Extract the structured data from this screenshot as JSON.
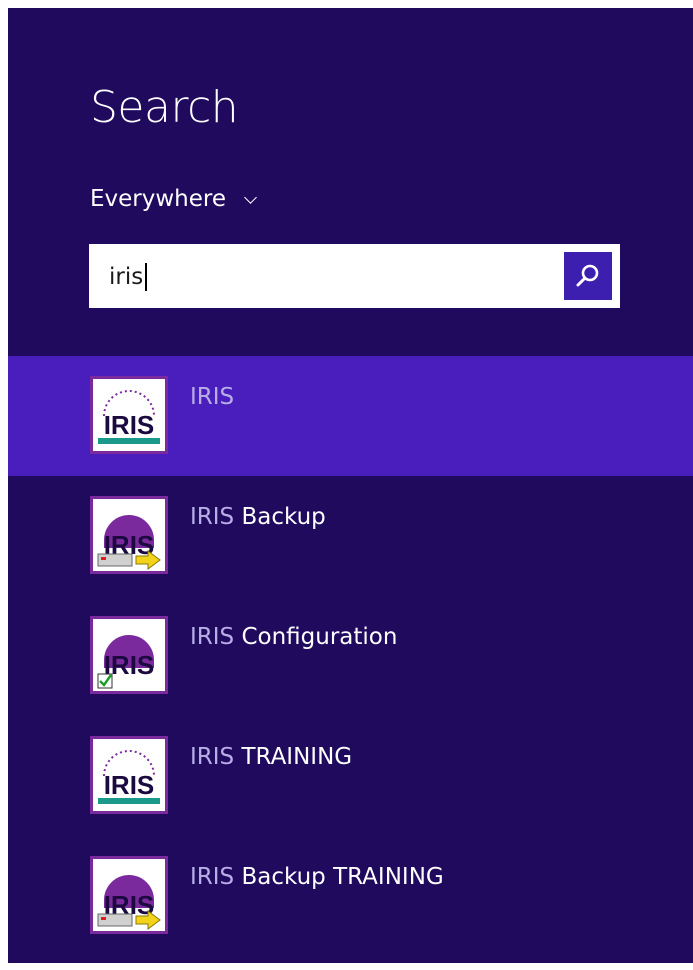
{
  "header": {
    "title": "Search"
  },
  "scope": {
    "label": "Everywhere"
  },
  "search": {
    "value": "iris"
  },
  "results": [
    {
      "match": "IRIS",
      "rest": "",
      "icon": "iris-app-icon",
      "selected": true
    },
    {
      "match": "IRIS",
      "rest": " Backup",
      "icon": "iris-backup-icon",
      "selected": false
    },
    {
      "match": "IRIS",
      "rest": " Configuration",
      "icon": "iris-configuration-icon",
      "selected": false
    },
    {
      "match": "IRIS",
      "rest": " TRAINING",
      "icon": "iris-app-icon",
      "selected": false
    },
    {
      "match": "IRIS",
      "rest": " Backup TRAINING",
      "icon": "iris-backup-icon",
      "selected": false
    }
  ],
  "icon_text": "IRIS",
  "colors": {
    "panel_bg": "#1f0a5e",
    "selected_bg": "#4a1dbd",
    "search_button": "#3d1fb0",
    "match_text": "#b8aee6",
    "icon_bg": "#7a2a9c",
    "icon_teal": "#1a9a8a"
  }
}
